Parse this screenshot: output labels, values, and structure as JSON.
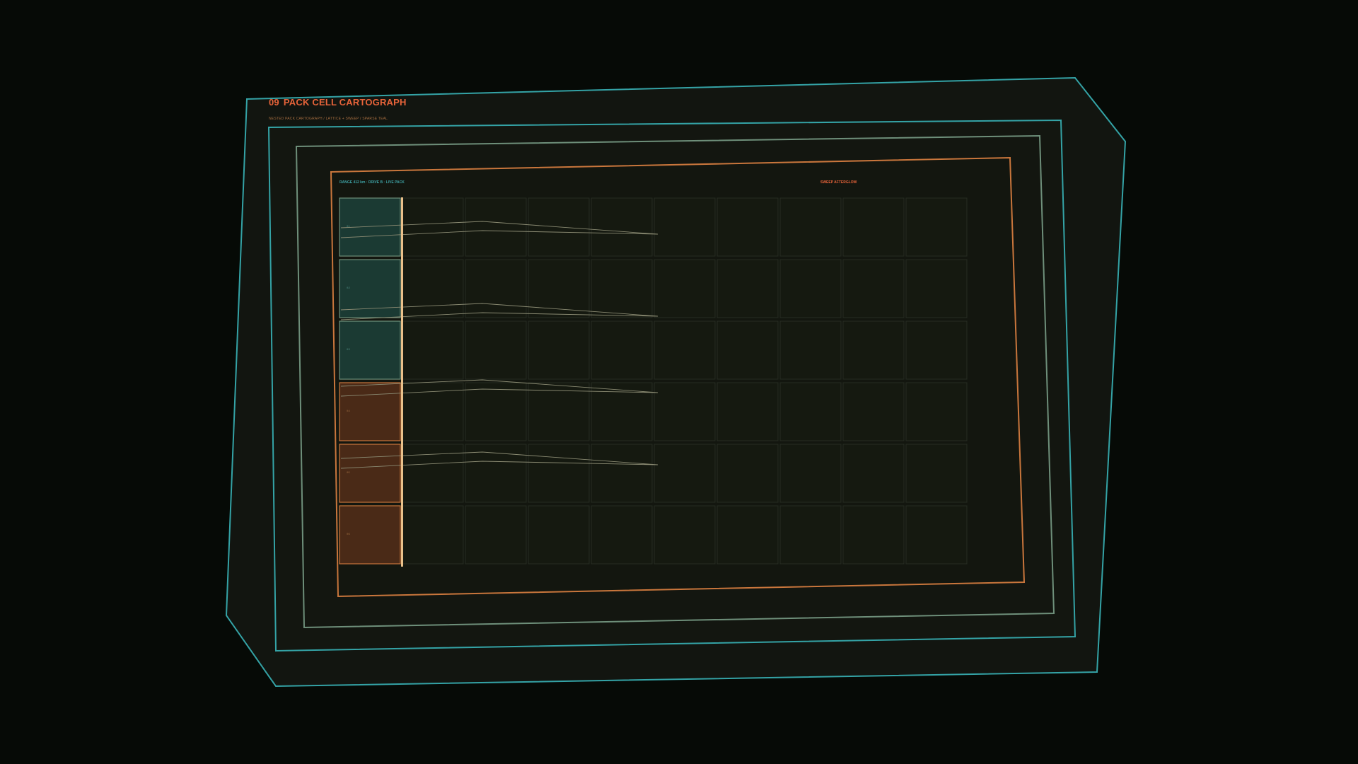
{
  "header": {
    "number": "09",
    "title": "PACK CELL CARTOGRAPH",
    "subtitle": "NESTED PACK CARTOGRAPH / LATTICE + SWEEP / SPARSE TEAL"
  },
  "readout": {
    "label": "RANGE 412 km · DRIVE B · LIVE PACK"
  },
  "sweep": {
    "label": "SWEEP AFTERGLOW"
  },
  "grid": {
    "rows": 6,
    "cols": 10,
    "row_labels": [
      "01",
      "02",
      "03",
      "04",
      "05",
      "06"
    ],
    "row_states": [
      "teal",
      "teal",
      "teal",
      "amber",
      "amber",
      "amber"
    ]
  },
  "colors": {
    "background": "#060a06",
    "panel": "#121510",
    "teal": "#34a3a6",
    "sage": "#6e8f7a",
    "amber": "#c9763c",
    "accent": "#e8643a",
    "cell_teal": "#1b3a33",
    "cell_amber": "#4a2a17",
    "grid_line": "#262c22"
  }
}
